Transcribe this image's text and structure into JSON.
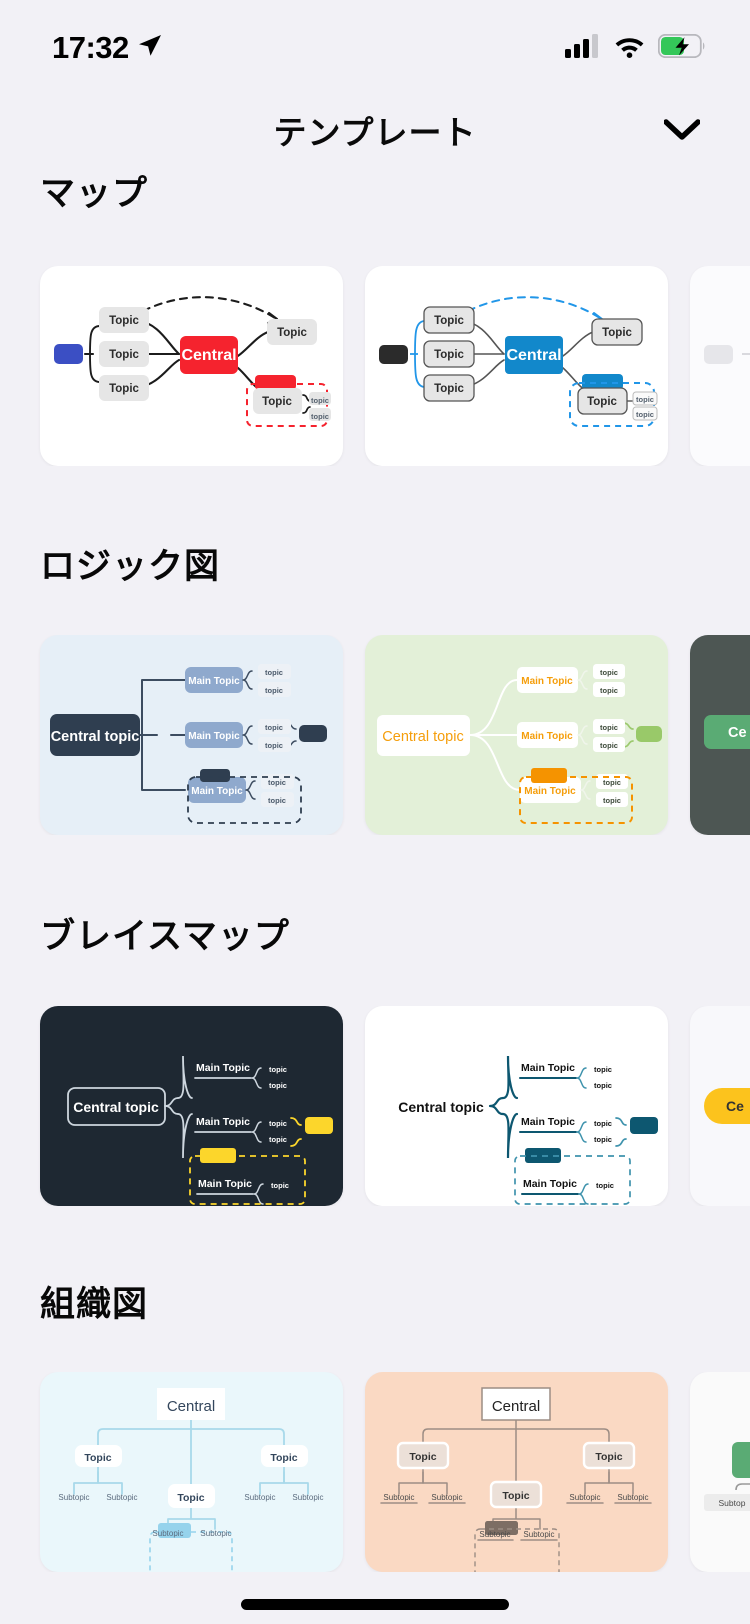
{
  "status_bar": {
    "time": "17:32",
    "icons": {
      "location": "location-arrow-icon",
      "signal": "cellular-signal-icon",
      "wifi": "wifi-icon",
      "battery": "battery-charging-icon"
    }
  },
  "header": {
    "title": "テンプレート",
    "chevron": "chevron-down-icon"
  },
  "sections": [
    {
      "key": "map",
      "title": "マップ",
      "cards": [
        {
          "name": "map-template-red",
          "bg": "#ffffff",
          "central": "Central",
          "central_fill": "#f5232e",
          "central_text": "#ffffff",
          "topics": [
            "Topic",
            "Topic",
            "Topic",
            "Topic",
            "Topic"
          ],
          "subtopics": [
            "topic",
            "topic"
          ],
          "chip_left": "#3b4fc4",
          "chip_accent": "#f5232e",
          "boundary": "#f5232e"
        },
        {
          "name": "map-template-blue",
          "bg": "#ffffff",
          "central": "Central",
          "central_fill": "#1288cb",
          "central_text": "#ffffff",
          "topics": [
            "Topic",
            "Topic",
            "Topic",
            "Topic",
            "Topic"
          ],
          "subtopics": [
            "topic",
            "topic"
          ],
          "chip_left": "#2b2b2b",
          "chip_accent": "#1288cb",
          "boundary": "#2196e8"
        },
        {
          "name": "map-template-partial",
          "bg": "#fbfbfd",
          "central": "",
          "central_fill": "#e6e6ea",
          "central_text": "#333333",
          "topics": [],
          "subtopics": [],
          "chip_left": "#e6e6ea",
          "chip_accent": "#e6e6ea",
          "boundary": "#d9d9de"
        }
      ]
    },
    {
      "key": "logic",
      "title": "ロジック図",
      "cards": [
        {
          "name": "logic-template-navy",
          "bg": "#e6eff7",
          "central": "Central topic",
          "central_fill": "#2f3e50",
          "central_text": "#ffffff",
          "mains": [
            "Main Topic",
            "Main Topic",
            "Main Topic"
          ],
          "subtopics": [
            "topic",
            "topic"
          ],
          "node_fill": "#8fa9cd",
          "node_text": "#2f3e50",
          "line": "#3c4c60",
          "chip_accent": "#2f3e50",
          "boundary": "#2f3e50"
        },
        {
          "name": "logic-template-green",
          "bg": "#e3f0d8",
          "central": "Central topic",
          "central_fill": "#ffffff",
          "central_text": "#f59e0b",
          "mains": [
            "Main Topic",
            "Main Topic",
            "Main Topic"
          ],
          "subtopics": [
            "topic",
            "topic"
          ],
          "node_fill": "#ffffff",
          "node_text": "#f59e0b",
          "line": "#ffffff",
          "chip_accent": "#99c969",
          "boundary": "#f59300"
        },
        {
          "name": "logic-template-dark",
          "bg": "#4d5653",
          "central": "Ce",
          "central_fill": "#5aab74",
          "central_text": "#ffffff",
          "mains": [],
          "subtopics": [],
          "node_fill": "#5aab74",
          "node_text": "#ffffff",
          "line": "#8d9a95",
          "chip_accent": "#5aab74",
          "boundary": "#5aab74"
        }
      ]
    },
    {
      "key": "brace",
      "title": "ブレイスマップ",
      "cards": [
        {
          "name": "brace-template-dark",
          "bg": "#1e2832",
          "central": "Central topic",
          "central_fill": "transparent",
          "central_text": "#ffffff",
          "mains": [
            "Main Topic",
            "Main Topic",
            "Main Topic"
          ],
          "subtopics": [
            "topic",
            "topic"
          ],
          "line": "#cdd6de",
          "chip_accent": "#fcd62b",
          "boundary": "#fcd62b"
        },
        {
          "name": "brace-template-white",
          "bg": "#ffffff",
          "central": "Central topic",
          "central_fill": "transparent",
          "central_text": "#111111",
          "mains": [
            "Main Topic",
            "Main Topic",
            "Main Topic"
          ],
          "subtopics": [
            "topic",
            "topic"
          ],
          "line": "#0d5770",
          "chip_accent": "#0d5770",
          "boundary": "#3f93ad"
        },
        {
          "name": "brace-template-yellow",
          "bg": "#f8f8fb",
          "central": "Ce",
          "central_fill": "#fcc31d",
          "central_text": "#333333",
          "mains": [],
          "subtopics": [],
          "line": "#cccccc",
          "chip_accent": "#fcc31d",
          "boundary": "#fcc31d"
        }
      ]
    },
    {
      "key": "org",
      "title": "組織図",
      "cards": [
        {
          "name": "org-template-cyan",
          "bg": "#eaf7fb",
          "central": "Central",
          "central_fill": "#ffffff",
          "central_text": "#33465c",
          "topics": [
            "Topic",
            "Topic",
            "Topic"
          ],
          "subtopics": [
            "Subtopic",
            "Subtopic",
            "Subtopic",
            "Subtopic",
            "Subtopic",
            "Subtopic"
          ],
          "node_fill": "#ffffff",
          "line": "#a8d9ea",
          "chip_accent": "#96d3ec",
          "boundary": "#96d3ec"
        },
        {
          "name": "org-template-peach",
          "bg": "#fad9c3",
          "central": "Central",
          "central_fill": "#ffffff",
          "central_text": "#222222",
          "topics": [
            "Topic",
            "Topic",
            "Topic"
          ],
          "subtopics": [
            "Subtopic",
            "Subtopic",
            "Subtopic",
            "Subtopic",
            "Subtopic",
            "Subtopic"
          ],
          "node_fill": "#ece0d8",
          "line": "#9c8d84",
          "chip_accent": "#7d6e64",
          "boundary": "#9c8d84"
        },
        {
          "name": "org-template-green",
          "bg": "#fafafa",
          "central": "",
          "central_fill": "#5aab74",
          "central_text": "#ffffff",
          "topics": [],
          "subtopics": [
            "Subtop"
          ],
          "node_fill": "#ececec",
          "line": "#999999",
          "chip_accent": "#5aab74",
          "boundary": "#5aab74"
        }
      ]
    }
  ]
}
